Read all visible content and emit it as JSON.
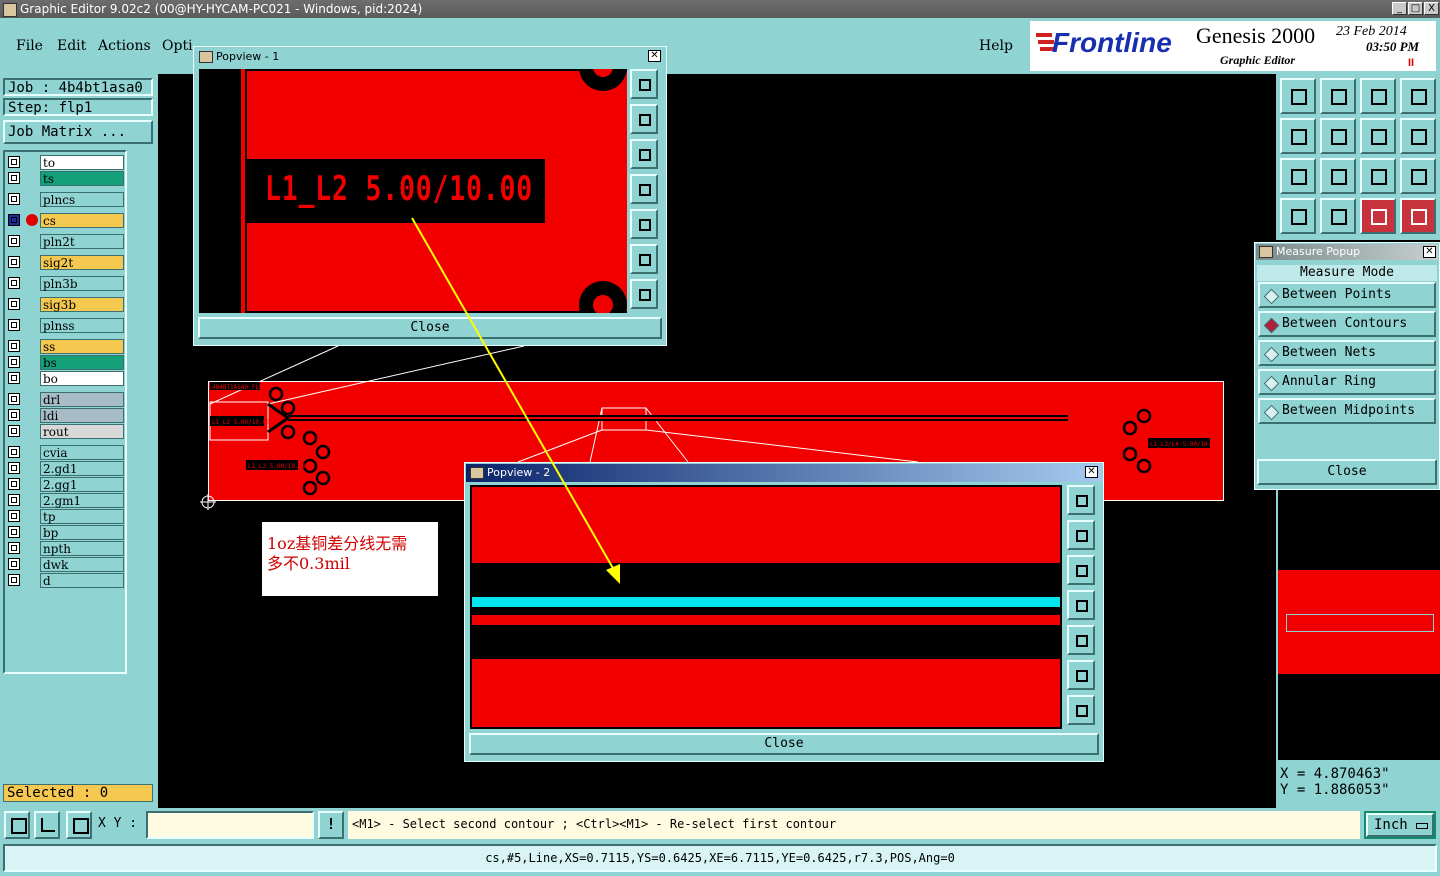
{
  "window": {
    "title": "Graphic Editor 9.02c2 (00@HY-HYCAM-PC021 - Windows, pid:2024)",
    "controls": [
      "_",
      "□",
      "X"
    ]
  },
  "menubar": {
    "items": [
      "File",
      "Edit",
      "Actions",
      "Opti"
    ],
    "help": "Help"
  },
  "logo": {
    "brand": "Frontline",
    "product": "Genesis 2000",
    "subtitle": "Graphic Editor",
    "date": "23 Feb 2014",
    "time": "03:50 PM",
    "pause": "II"
  },
  "job": {
    "job_label": "Job : 4b4bt1asa0",
    "step_label": "Step: flp1",
    "matrix_button": "Job Matrix ..."
  },
  "layers": [
    {
      "name": "to",
      "color": "#ffffff"
    },
    {
      "name": "ts",
      "color": "#14a078"
    },
    {
      "name": "plncs",
      "color": "#8fd3d3"
    },
    {
      "name": "cs",
      "color": "#f5c850",
      "active": true
    },
    {
      "name": "pln2t",
      "color": "#8fd3d3"
    },
    {
      "name": "sig2t",
      "color": "#f5c850"
    },
    {
      "name": "pln3b",
      "color": "#8fd3d3"
    },
    {
      "name": "sig3b",
      "color": "#f5c850"
    },
    {
      "name": "plnss",
      "color": "#8fd3d3"
    },
    {
      "name": "ss",
      "color": "#f5c850"
    },
    {
      "name": "bs",
      "color": "#14a078"
    },
    {
      "name": "bo",
      "color": "#ffffff"
    },
    {
      "name": "drl",
      "color": "#a8bcc8"
    },
    {
      "name": "ldi",
      "color": "#a8bcc8"
    },
    {
      "name": "rout",
      "color": "#d8d8d8"
    },
    {
      "name": "cvia",
      "color": "#8fd3d3"
    },
    {
      "name": "2.gd1",
      "color": "#8fd3d3"
    },
    {
      "name": "2.gg1",
      "color": "#8fd3d3"
    },
    {
      "name": "2.gm1",
      "color": "#8fd3d3"
    },
    {
      "name": "tp",
      "color": "#8fd3d3"
    },
    {
      "name": "bp",
      "color": "#8fd3d3"
    },
    {
      "name": "npth",
      "color": "#8fd3d3"
    },
    {
      "name": "dwk",
      "color": "#8fd3d3"
    },
    {
      "name": "d",
      "color": "#8fd3d3"
    }
  ],
  "selected": "Selected : 0",
  "popview1": {
    "title": "Popview - 1",
    "text": "L1_L2 5.00/10.00",
    "close": "Close"
  },
  "popview2": {
    "title": "Popview - 2",
    "close": "Close"
  },
  "board": {
    "small_text_1": "4B4BT1ASA0 FLP1",
    "small_text_2": "L1_L2 5.00/10.00",
    "small_text_3": "L1_L2 5.00/10.00",
    "small_text_4": "L1_L2/L4 5.00/10.00"
  },
  "note": {
    "line1": "1oz基铜差分线无需",
    "line2": "多不0.3mil"
  },
  "measure": {
    "title": "Measure Popup",
    "heading": "Measure Mode",
    "options": [
      "Between Points",
      "Between Contours",
      "Between Nets",
      "Annular Ring",
      "Between Midpoints"
    ],
    "selected": "Between Contours",
    "close": "Close"
  },
  "coords": {
    "x": "X = 4.870463\"",
    "y": "Y = 1.886053\""
  },
  "status": {
    "xy_label": "X Y :",
    "xy_value": "",
    "message": "<M1> - Select second contour ; <Ctrl><M1> - Re-select first contour",
    "unit": "Inch"
  },
  "info": "cs,#5,Line,XS=0.7115,YS=0.6425,XE=6.7115,YE=0.6425,r7.3,POS,Ang=0",
  "colors": {
    "panel": "#8fd3d3",
    "copper": "#f20000",
    "trace_highlight": "#00e5ee",
    "arrow": "#ffff00"
  }
}
